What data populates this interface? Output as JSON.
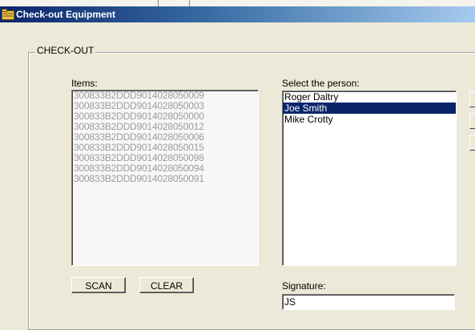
{
  "window": {
    "title": "Check-out Equipment",
    "icon": "folder-icon"
  },
  "group": {
    "legend": "CHECK-OUT"
  },
  "items": {
    "label": "Items:",
    "rows": [
      "300833B2DDD9014028050009",
      "300833B2DDD9014028050003",
      "300833B2DDD9014028050000",
      "300833B2DDD9014028050012",
      "300833B2DDD9014028050006",
      "300833B2DDD9014028050015",
      "300833B2DDD9014028050098",
      "300833B2DDD9014028050094",
      "300833B2DDD9014028050091"
    ]
  },
  "person": {
    "label": "Select the person:",
    "rows": [
      "Roger Daltry",
      "Joe Smith",
      "Mike Crotty"
    ],
    "selected": "Joe Smith"
  },
  "buttons": {
    "scan": "SCAN",
    "clear": "CLEAR"
  },
  "signature": {
    "label": "Signature:",
    "value": "JS"
  },
  "colors": {
    "selection": "#0a246a",
    "title_bar_start": "#0a246a",
    "title_bar_end": "#a6caf0",
    "disabled_text": "#9c9c9c"
  }
}
